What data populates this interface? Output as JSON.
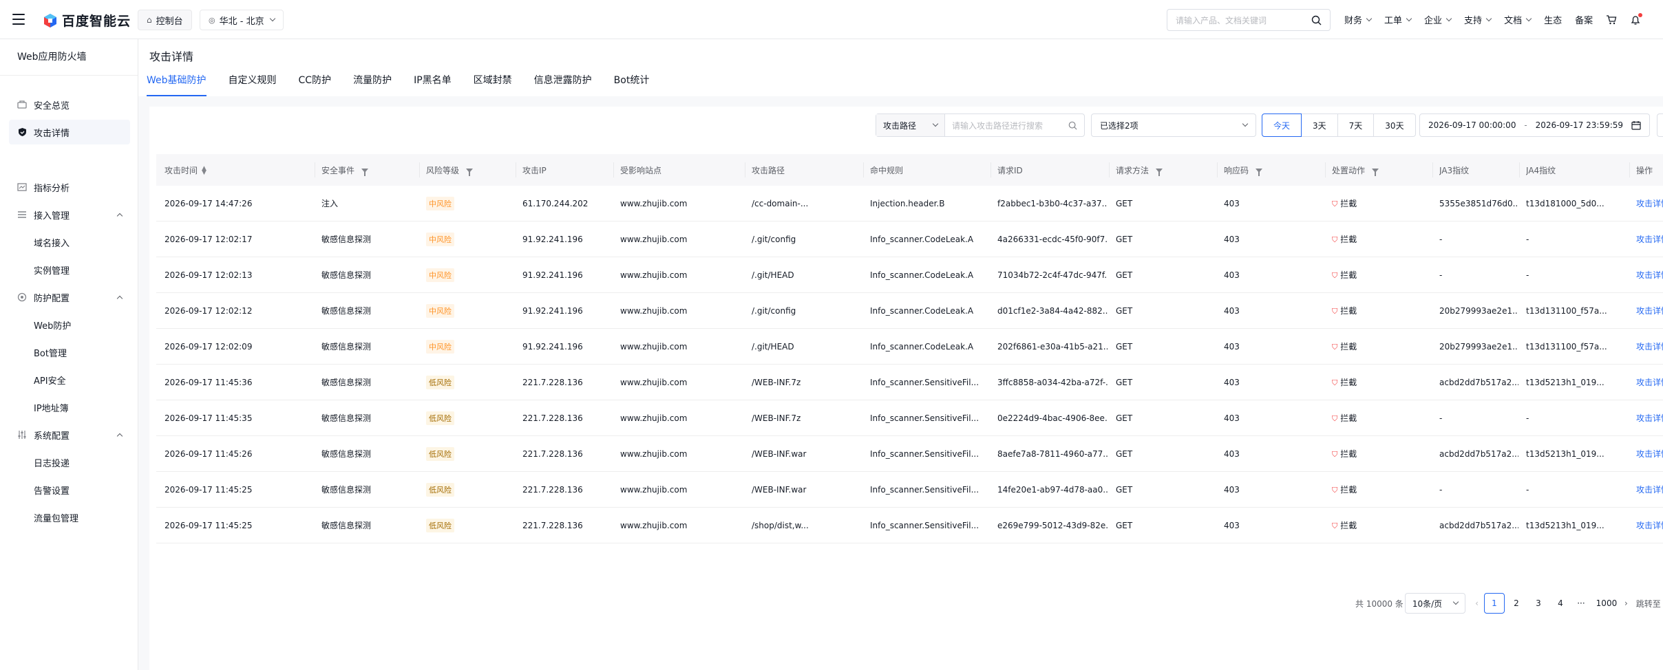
{
  "topbar": {
    "brand": "百度智能云",
    "console_label": "控制台",
    "region_label": "华北 - 北京",
    "search_placeholder": "请输入产品、文档关键词",
    "nav": [
      "财务",
      "工单",
      "企业",
      "支持",
      "文档",
      "生态",
      "备案"
    ]
  },
  "sidebar": {
    "title": "Web应用防火墙",
    "items": [
      {
        "label": "安全总览",
        "icon": "shield-overview-icon",
        "type": "item"
      },
      {
        "label": "攻击详情",
        "icon": "shield-icon",
        "type": "item",
        "active": true
      },
      {
        "label": "指标分析",
        "icon": "chart-icon",
        "type": "item"
      },
      {
        "label": "接入管理",
        "icon": "list-icon",
        "type": "group"
      },
      {
        "label": "域名接入",
        "type": "sub"
      },
      {
        "label": "实例管理",
        "type": "sub"
      },
      {
        "label": "防护配置",
        "icon": "gear-icon",
        "type": "group"
      },
      {
        "label": "Web防护",
        "type": "sub"
      },
      {
        "label": "Bot管理",
        "type": "sub"
      },
      {
        "label": "API安全",
        "type": "sub"
      },
      {
        "label": "IP地址簿",
        "type": "sub"
      },
      {
        "label": "系统配置",
        "icon": "sliders-icon",
        "type": "group"
      },
      {
        "label": "日志投递",
        "type": "sub"
      },
      {
        "label": "告警设置",
        "type": "sub"
      },
      {
        "label": "流量包管理",
        "type": "sub"
      }
    ]
  },
  "page": {
    "title": "攻击详情",
    "tabs": [
      "Web基础防护",
      "自定义规则",
      "CC防护",
      "流量防护",
      "IP黑名单",
      "区域封禁",
      "信息泄露防护",
      "Bot统计"
    ]
  },
  "filters": {
    "field_select": "攻击路径",
    "search_placeholder": "请输入攻击路径进行搜索",
    "multi_select": "已选择2项",
    "ranges": [
      "今天",
      "3天",
      "7天",
      "30天"
    ],
    "active_range": "今天",
    "start_time": "2026-09-17 00:00:00",
    "separator": "-",
    "end_time": "2026-09-17 23:59:59"
  },
  "table": {
    "columns": [
      "攻击时间",
      "安全事件",
      "风险等级",
      "攻击IP",
      "受影响站点",
      "攻击路径",
      "命中规则",
      "请求ID",
      "请求方法",
      "响应码",
      "处置动作",
      "JA3指纹",
      "JA4指纹",
      "操作"
    ],
    "rows": [
      [
        "2026-09-17 14:47:26",
        "注入",
        "中风险",
        "61.170.244.202",
        "www.zhujib.com",
        "/cc-domain-...",
        "Injection.header.B",
        "f2abbec1-b3b0-4c37-a37...",
        "GET",
        "403",
        "拦截",
        "5355e3851d76d0...",
        "t13d181000_5d0...",
        "攻击详情"
      ],
      [
        "2026-09-17 12:02:17",
        "敏感信息探测",
        "中风险",
        "91.92.241.196",
        "www.zhujib.com",
        "/.git/config",
        "Info_scanner.CodeLeak.A",
        "4a266331-ecdc-45f0-90f7...",
        "GET",
        "403",
        "拦截",
        "-",
        "-",
        "攻击详情"
      ],
      [
        "2026-09-17 12:02:13",
        "敏感信息探测",
        "中风险",
        "91.92.241.196",
        "www.zhujib.com",
        "/.git/HEAD",
        "Info_scanner.CodeLeak.A",
        "71034b72-2c4f-47dc-947f...",
        "GET",
        "403",
        "拦截",
        "-",
        "-",
        "攻击详情"
      ],
      [
        "2026-09-17 12:02:12",
        "敏感信息探测",
        "中风险",
        "91.92.241.196",
        "www.zhujib.com",
        "/.git/config",
        "Info_scanner.CodeLeak.A",
        "d01cf1e2-3a84-4a42-882...",
        "GET",
        "403",
        "拦截",
        "20b279993ae2e1...",
        "t13d131100_f57a...",
        "攻击详情"
      ],
      [
        "2026-09-17 12:02:09",
        "敏感信息探测",
        "中风险",
        "91.92.241.196",
        "www.zhujib.com",
        "/.git/HEAD",
        "Info_scanner.CodeLeak.A",
        "202f6861-e30a-41b5-a21...",
        "GET",
        "403",
        "拦截",
        "20b279993ae2e1...",
        "t13d131100_f57a...",
        "攻击详情"
      ],
      [
        "2026-09-17 11:45:36",
        "敏感信息探测",
        "低风险",
        "221.7.228.136",
        "www.zhujib.com",
        "/WEB-INF.7z",
        "Info_scanner.SensitiveFil...",
        "3ffc8858-a034-42ba-a72f-...",
        "GET",
        "403",
        "拦截",
        "acbd2dd7b517a2...",
        "t13d5213h1_019...",
        "攻击详情"
      ],
      [
        "2026-09-17 11:45:35",
        "敏感信息探测",
        "低风险",
        "221.7.228.136",
        "www.zhujib.com",
        "/WEB-INF.7z",
        "Info_scanner.SensitiveFil...",
        "0e2224d9-4bac-4906-8ee...",
        "GET",
        "403",
        "拦截",
        "-",
        "-",
        "攻击详情"
      ],
      [
        "2026-09-17 11:45:26",
        "敏感信息探测",
        "低风险",
        "221.7.228.136",
        "www.zhujib.com",
        "/WEB-INF.war",
        "Info_scanner.SensitiveFil...",
        "8aefe7a8-7811-4960-a77...",
        "GET",
        "403",
        "拦截",
        "acbd2dd7b517a2...",
        "t13d5213h1_019...",
        "攻击详情"
      ],
      [
        "2026-09-17 11:45:25",
        "敏感信息探测",
        "低风险",
        "221.7.228.136",
        "www.zhujib.com",
        "/WEB-INF.war",
        "Info_scanner.SensitiveFil...",
        "14fe20e1-ab97-4d78-aa0...",
        "GET",
        "403",
        "拦截",
        "-",
        "-",
        "攻击详情"
      ],
      [
        "2026-09-17 11:45:25",
        "敏感信息探测",
        "低风险",
        "221.7.228.136",
        "www.zhujib.com",
        "/shop/dist,w...",
        "Info_scanner.SensitiveFil...",
        "e269e799-5012-43d9-82e...",
        "GET",
        "403",
        "拦截",
        "acbd2dd7b517a2...",
        "t13d5213h1_019...",
        "攻击详情"
      ]
    ]
  },
  "pagination": {
    "total": "共 10000 条",
    "page_size": "10条/页",
    "pages": [
      "1",
      "2",
      "3",
      "4",
      "···",
      "1000"
    ],
    "current": "1",
    "jump_label": "跳转至"
  },
  "colors": {
    "accent": "#2468f2",
    "mid_risk": "#ff9326",
    "block_icon": "#f33e3e"
  }
}
